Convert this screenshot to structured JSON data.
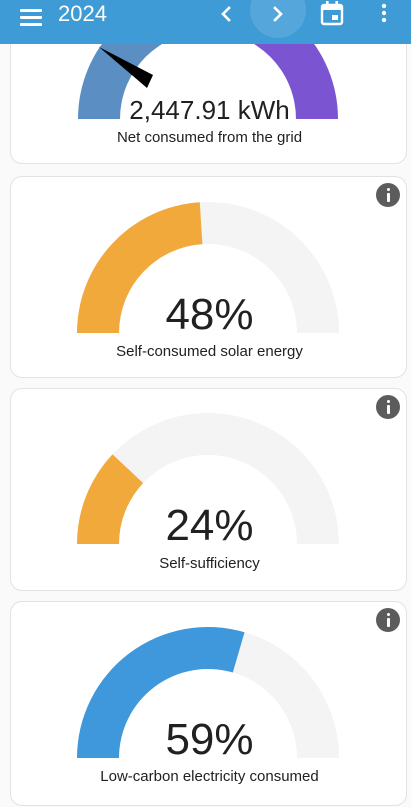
{
  "header": {
    "title": "2024",
    "background": "#3e9bd6",
    "icons": [
      "menu-icon",
      "chevron-left-icon",
      "chevron-right-icon",
      "calendar-icon",
      "more-vert-icon"
    ]
  },
  "grid_card": {
    "value": "2,447.91 kWh",
    "label": "Net consumed from the grid",
    "colors": {
      "low": "#5b8fc3",
      "high": "#7b54d2"
    }
  },
  "solar_card": {
    "value": "48%",
    "label": "Self-consumed solar energy",
    "percent": 48,
    "color": "#f2a93b"
  },
  "sufficiency_card": {
    "value": "24%",
    "label": "Self-sufficiency",
    "percent": 24,
    "color": "#f2a93b"
  },
  "carbon_card": {
    "value": "59%",
    "label": "Low-carbon electricity consumed",
    "percent": 59,
    "color": "#3f98dc"
  },
  "gauge_track_color": "#f4f4f4"
}
